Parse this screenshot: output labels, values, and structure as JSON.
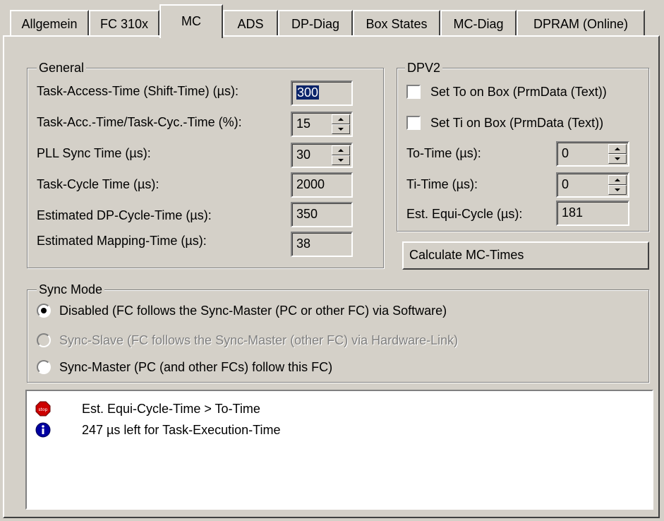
{
  "tabs": [
    {
      "label": "Allgemein"
    },
    {
      "label": "FC 310x"
    },
    {
      "label": "MC"
    },
    {
      "label": "ADS"
    },
    {
      "label": "DP-Diag"
    },
    {
      "label": "Box States"
    },
    {
      "label": "MC-Diag"
    },
    {
      "label": "DPRAM (Online)"
    }
  ],
  "active_tab": "MC",
  "general": {
    "title": "General",
    "task_access_time": {
      "label": "Task-Access-Time (Shift-Time) (µs):",
      "value": "300"
    },
    "task_acc_ratio": {
      "label": "Task-Acc.-Time/Task-Cyc.-Time (%):",
      "value": "15"
    },
    "pll_sync_time": {
      "label": "PLL Sync Time (µs):",
      "value": "30"
    },
    "task_cycle_time": {
      "label": "Task-Cycle Time (µs):",
      "value": "2000"
    },
    "est_dp_cycle_time": {
      "label": "Estimated DP-Cycle-Time (µs):",
      "value": "350"
    },
    "est_mapping_time": {
      "label": "Estimated Mapping-Time (µs):",
      "value": "38"
    }
  },
  "dpv2": {
    "title": "DPV2",
    "set_to": {
      "label": "Set To on Box (PrmData (Text))",
      "checked": false
    },
    "set_ti": {
      "label": "Set Ti on Box (PrmData (Text))",
      "checked": false
    },
    "to_time": {
      "label": "To-Time (µs):",
      "value": "0"
    },
    "ti_time": {
      "label": "Ti-Time (µs):",
      "value": "0"
    },
    "est_equi_cycle": {
      "label": "Est. Equi-Cycle (µs):",
      "value": "181"
    }
  },
  "calculate_button": {
    "label": "Calculate MC-Times"
  },
  "sync_mode": {
    "title": "Sync Mode",
    "options": [
      {
        "label": "Disabled (FC follows the Sync-Master (PC or other FC) via Software)",
        "selected": true,
        "enabled": true
      },
      {
        "label": "Sync-Slave (FC follows the Sync-Master (other FC) via Hardware-Link)",
        "selected": false,
        "enabled": false
      },
      {
        "label": "Sync-Master (PC (and other FCs) follow this FC)",
        "selected": false,
        "enabled": true
      }
    ]
  },
  "messages": [
    {
      "icon": "stop-icon",
      "text": "Est. Equi-Cycle-Time > To-Time"
    },
    {
      "icon": "info-icon",
      "text": "247 µs left for Task-Execution-Time"
    }
  ],
  "colors": {
    "stop": "#cc0000",
    "info": "#0000a0",
    "selection": "#0a246a",
    "face": "#d4d0c8"
  }
}
